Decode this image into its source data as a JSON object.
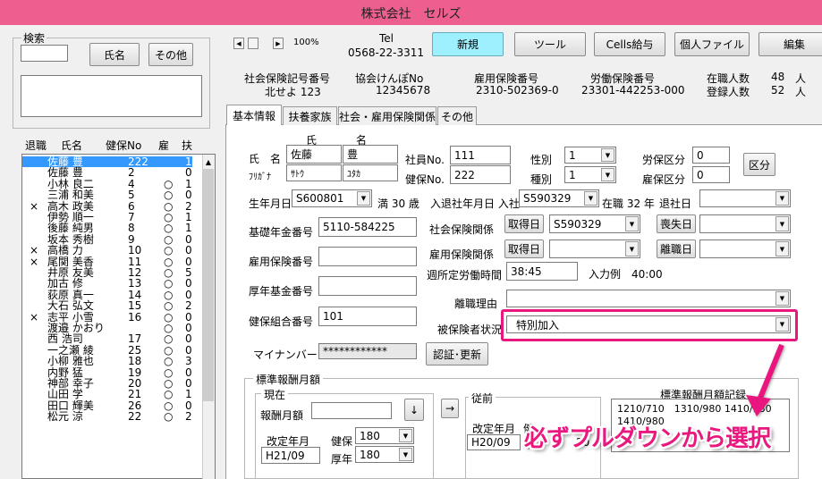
{
  "app": {
    "title": "株式会社　セルズ"
  },
  "search": {
    "group_label": "検索",
    "name_button": "氏名",
    "other_button": "その他"
  },
  "list": {
    "headers": {
      "retired": "退職",
      "name": "氏名",
      "kenpo_no": "健保No",
      "employment": "雇",
      "dependents": "扶"
    },
    "rows": [
      {
        "retired": "",
        "name": "佐藤 豊",
        "no": "222",
        "koyo": "",
        "fuyo": "1"
      },
      {
        "retired": "",
        "name": "佐藤 豊",
        "no": "2",
        "koyo": "",
        "fuyo": "0"
      },
      {
        "retired": "",
        "name": "小林 良二",
        "no": "4",
        "koyo": "○",
        "fuyo": "1"
      },
      {
        "retired": "",
        "name": "三浦 和美",
        "no": "5",
        "koyo": "○",
        "fuyo": "0"
      },
      {
        "retired": "×",
        "name": "高木 政美",
        "no": "6",
        "koyo": "○",
        "fuyo": "2"
      },
      {
        "retired": "",
        "name": "伊勢 順一",
        "no": "7",
        "koyo": "○",
        "fuyo": "1"
      },
      {
        "retired": "",
        "name": "後藤 純男",
        "no": "8",
        "koyo": "○",
        "fuyo": "1"
      },
      {
        "retired": "",
        "name": "坂本 秀樹",
        "no": "9",
        "koyo": "○",
        "fuyo": "0"
      },
      {
        "retired": "×",
        "name": "高橋 力",
        "no": "10",
        "koyo": "○",
        "fuyo": "0"
      },
      {
        "retired": "×",
        "name": "尾関 美香",
        "no": "11",
        "koyo": "○",
        "fuyo": "0"
      },
      {
        "retired": "",
        "name": "井原 友美",
        "no": "12",
        "koyo": "○",
        "fuyo": "5"
      },
      {
        "retired": "",
        "name": "加古 修",
        "no": "13",
        "koyo": "○",
        "fuyo": "0"
      },
      {
        "retired": "",
        "name": "荻原 真一",
        "no": "14",
        "koyo": "○",
        "fuyo": "0"
      },
      {
        "retired": "",
        "name": "大石 弘文",
        "no": "15",
        "koyo": "○",
        "fuyo": "2"
      },
      {
        "retired": "×",
        "name": "志平 小雪",
        "no": "16",
        "koyo": "○",
        "fuyo": "0"
      },
      {
        "retired": "",
        "name": "渡邉 かおり",
        "no": "",
        "koyo": "○",
        "fuyo": "0"
      },
      {
        "retired": "",
        "name": "西 浩司",
        "no": "17",
        "koyo": "○",
        "fuyo": "0"
      },
      {
        "retired": "",
        "name": "一之瀬 綾",
        "no": "25",
        "koyo": "○",
        "fuyo": "0"
      },
      {
        "retired": "",
        "name": "小柳 雅也",
        "no": "18",
        "koyo": "○",
        "fuyo": "3"
      },
      {
        "retired": "",
        "name": "内野 猛",
        "no": "19",
        "koyo": "○",
        "fuyo": "0"
      },
      {
        "retired": "",
        "name": "神部 幸子",
        "no": "20",
        "koyo": "○",
        "fuyo": "0"
      },
      {
        "retired": "",
        "name": "山田 学",
        "no": "21",
        "koyo": "○",
        "fuyo": "1"
      },
      {
        "retired": "",
        "name": "田口 輝美",
        "no": "26",
        "koyo": "○",
        "fuyo": "0"
      },
      {
        "retired": "",
        "name": "松元 涼",
        "no": "22",
        "koyo": "○",
        "fuyo": "2"
      }
    ]
  },
  "nav": {
    "zoom": "100%",
    "tel_label": "Tel",
    "tel_value": "0568-22-3311"
  },
  "toolbar": {
    "new": "新規",
    "tools": "ツール",
    "cells_salary": "Cells給与",
    "personal_file": "個人ファイル",
    "edit": "編集"
  },
  "company": {
    "shaho_label": "社会保険記号番号",
    "shaho_value": "北せよ 123",
    "kyokai_label": "協会けんぽNo",
    "kyokai_value": "12345678",
    "koyo_label": "雇用保険番号",
    "koyo_value": "2310-502369-0",
    "rodo_label": "労働保険番号",
    "rodo_value": "23301-442253-000",
    "zaishoku_label": "在職人数",
    "zaishoku_value": "48",
    "touroku_label": "登録人数",
    "touroku_value": "52",
    "unit": "人"
  },
  "tabs": [
    "基本情報",
    "扶養家族",
    "社会・雇用保険関係",
    "その他"
  ],
  "form": {
    "sei_label": "氏",
    "mei_label": "名",
    "name_label": "氏　名",
    "kana_label": "ﾌﾘｶﾞﾅ",
    "sei": "佐藤",
    "mei": "豊",
    "sei_kana": "ｻﾄｳ",
    "mei_kana": "ﾕﾀｶ",
    "shain_label": "社員No.",
    "shain_value": "111",
    "kenpo_label": "健保No.",
    "kenpo_value": "222",
    "seibetsu_label": "性別",
    "seibetsu_value": "1",
    "shubetsu_label": "種別",
    "shubetsu_value": "1",
    "rosai_label": "労保区分",
    "rosai_value": "0",
    "koho_label": "雇保区分",
    "koho_value": "0",
    "kubun_button": "区分",
    "birth_label": "生年月日",
    "birth_value": "S600801",
    "age_text": "満 30 歳",
    "hire_label": "入退社年月日 入社",
    "hire_value": "S590329",
    "tenure_text": "在職 32 年",
    "retire_label": "退社日",
    "nenkin_label": "基礎年金番号",
    "nenkin_value": "5110-584225",
    "koyo_no_label": "雇用保険番号",
    "kosei_label": "厚年基金番号",
    "kumiai_label": "健保組合番号",
    "kumiai_value": "101",
    "mynumber_label": "マイナンバー",
    "mynumber_value": "************",
    "auth_button": "認証･更新",
    "shaho_kankei_label": "社会保険関係",
    "acquire_button": "取得日",
    "acquire_value": "S590329",
    "loss_button": "喪失日",
    "koyo_kankei_label": "雇用保険関係",
    "retire_button": "離職日",
    "hours_label": "週所定労働時間",
    "hours_value": "38:45",
    "example_text": "入力例　40:00",
    "reason_label": "離職理由",
    "status_label": "被保険者状況",
    "status_value": "特別加入"
  },
  "hyojun": {
    "group_label": "標準報酬月額",
    "current_label": "現在",
    "monthly_label": "報酬月額",
    "down_button": "↓",
    "arrow_button": "→",
    "kaitei_label": "改定年月",
    "kaitei_value": "H21/09",
    "kenpo_label": "健保",
    "kenpo_value": "180",
    "kounen_label": "厚年",
    "kounen_value": "180",
    "prev_label": "従前",
    "prev_kaitei_label": "改定年月",
    "prev_kaitei_value": "H20/09",
    "prev_ken_label": "健",
    "prev_shaho_label": "厚",
    "prev_value": "20",
    "record_label": "標準報酬月額記録",
    "record_line1": "1210/710　1310/980 1410/980",
    "record_line2": "1410/980"
  },
  "annotation": {
    "callout": "必ずプルダウンから選択",
    "color": "#e8187e"
  }
}
